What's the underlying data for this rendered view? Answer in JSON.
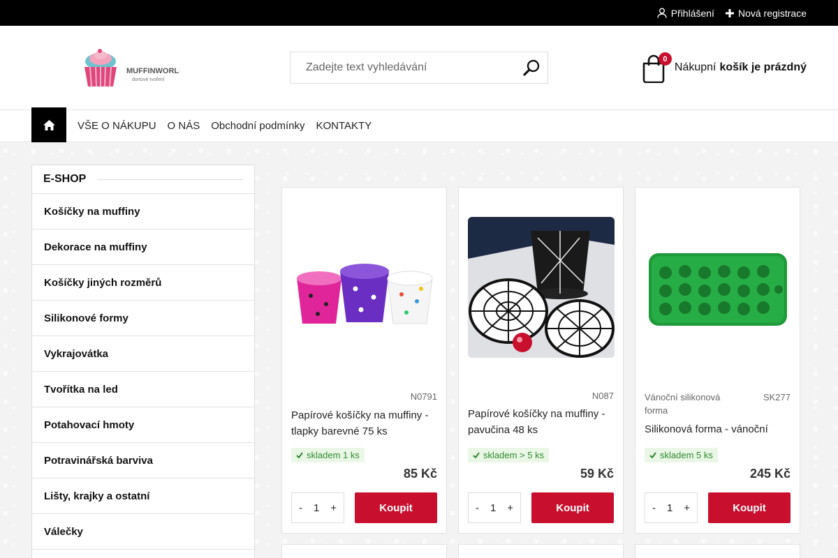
{
  "topbar": {
    "login": "Přihlášení",
    "register": "Nová registrace"
  },
  "header": {
    "logo_text": "MUFFINWORLD",
    "logo_sub": "dortové tvoření",
    "search_placeholder": "Zadejte text vyhledávání",
    "cart": {
      "count": "0",
      "label_prefix": "Nákupní",
      "label_bold": "košík je prázdný"
    }
  },
  "nav": {
    "items": [
      {
        "label": "VŠE O NÁKUPU"
      },
      {
        "label": "O NÁS"
      },
      {
        "label": "Obchodní podmínky"
      },
      {
        "label": "KONTAKTY"
      }
    ]
  },
  "sidebar": {
    "title": "E-SHOP",
    "categories": [
      "Košíčky na muffiny",
      "Dekorace na muffiny",
      "Košíčky jiných rozměrů",
      "Silikonové formy",
      "Vykrajovátka",
      "Tvořítka na led",
      "Potahovací hmoty",
      "Potravinářská barviva",
      "Lišty, krajky a ostatní",
      "Válečky"
    ]
  },
  "products": [
    {
      "code": "N0791",
      "category": "",
      "name": "Papírové košíčky na muffiny - tlapky barevné 75 ks",
      "stock": "skladem 1 ks",
      "price": "85 Kč",
      "qty": "1",
      "buy": "Koupit"
    },
    {
      "code": "N087",
      "category": "",
      "name": "Papírové košíčky na muffiny - pavučina 48 ks",
      "stock": "skladem > 5 ks",
      "price": "59 Kč",
      "qty": "1",
      "buy": "Koupit"
    },
    {
      "code": "SK277",
      "category": "Vánoční silikonová forma",
      "name": "Silikonová forma - vánoční",
      "stock": "skladem 5 ks",
      "price": "245 Kč",
      "qty": "1",
      "buy": "Koupit"
    }
  ],
  "qty_minus": "-",
  "qty_plus": "+",
  "colors": {
    "accent": "#c8102e",
    "topbar": "#000000",
    "stock_green": "#2e8b2e"
  }
}
